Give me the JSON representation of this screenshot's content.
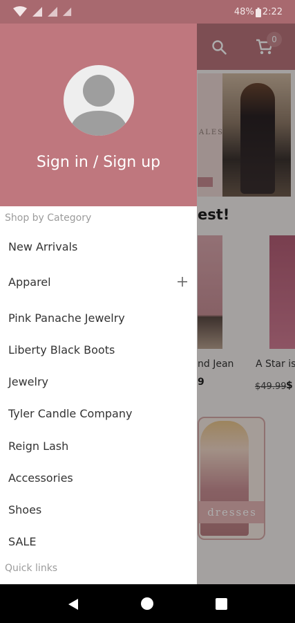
{
  "status_bar": {
    "battery_percent": "48%",
    "time": "2:22",
    "icons": [
      "wifi-icon",
      "signal-icon",
      "signal-icon",
      "signal-icon",
      "battery-icon"
    ]
  },
  "background": {
    "cart_count": "0",
    "heading_partial": "est!",
    "product1_title": "nd Jean",
    "product1_price": "9",
    "product2_title": "A Star is",
    "product2_old_price": "$49.99",
    "product2_price": "$",
    "banner_text": "ALES",
    "promo_label": "dresses"
  },
  "drawer": {
    "header_color": "#bf777e",
    "sign_in_label": "Sign in / Sign up",
    "shop_by_category_label": "Shop by Category",
    "categories": [
      {
        "label": "New Arrivals"
      },
      {
        "label": "Apparel",
        "expandable": true
      },
      {
        "label": "Pink Panache Jewelry"
      },
      {
        "label": "Liberty Black Boots"
      },
      {
        "label": "Jewelry"
      },
      {
        "label": "Tyler Candle Company"
      },
      {
        "label": "Reign Lash"
      },
      {
        "label": "Accessories"
      },
      {
        "label": "Shoes"
      },
      {
        "label": "SALE"
      }
    ],
    "quick_links_label": "Quick links"
  },
  "colors": {
    "brand": "#bf777e",
    "appbar": "#b9747b",
    "status_bar": "#a8696f"
  }
}
